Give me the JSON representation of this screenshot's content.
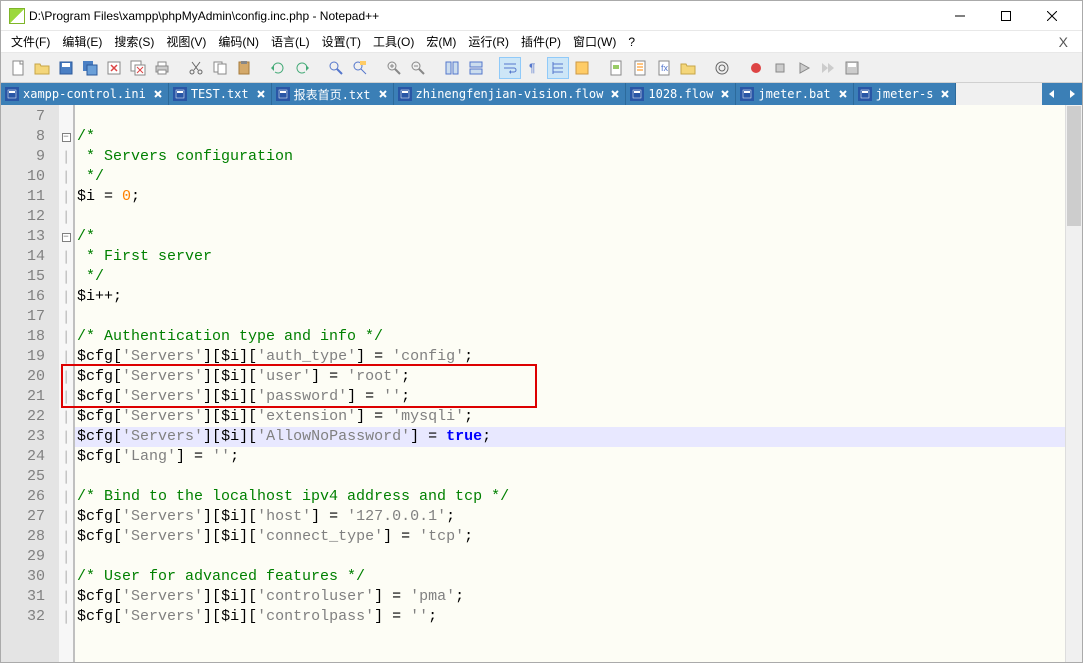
{
  "title": "D:\\Program Files\\xampp\\phpMyAdmin\\config.inc.php - Notepad++",
  "menu": [
    "文件(F)",
    "编辑(E)",
    "搜索(S)",
    "视图(V)",
    "编码(N)",
    "语言(L)",
    "设置(T)",
    "工具(O)",
    "宏(M)",
    "运行(R)",
    "插件(P)",
    "窗口(W)",
    "?"
  ],
  "tabs": [
    {
      "label": "xampp-control.ini"
    },
    {
      "label": "TEST.txt"
    },
    {
      "label": "报表首页.txt"
    },
    {
      "label": "zhinengfenjian-vision.flow"
    },
    {
      "label": "1028.flow"
    },
    {
      "label": "jmeter.bat"
    },
    {
      "label": "jmeter-s"
    }
  ],
  "startLine": 7,
  "lines": [
    {
      "n": 7,
      "fold": "",
      "tokens": []
    },
    {
      "n": 8,
      "fold": "box",
      "tokens": [
        [
          "c-comment",
          "/*"
        ]
      ]
    },
    {
      "n": 9,
      "fold": "|",
      "tokens": [
        [
          "c-comment",
          " * Servers configuration"
        ]
      ]
    },
    {
      "n": 10,
      "fold": "|",
      "tokens": [
        [
          "c-comment",
          " */"
        ]
      ]
    },
    {
      "n": 11,
      "fold": "|",
      "tokens": [
        [
          "c-var",
          "$i"
        ],
        [
          "c-op",
          " = "
        ],
        [
          "c-num",
          "0"
        ],
        [
          "c-op",
          ";"
        ]
      ]
    },
    {
      "n": 12,
      "fold": "|",
      "tokens": []
    },
    {
      "n": 13,
      "fold": "box",
      "tokens": [
        [
          "c-comment",
          "/*"
        ]
      ]
    },
    {
      "n": 14,
      "fold": "|",
      "tokens": [
        [
          "c-comment",
          " * First server"
        ]
      ]
    },
    {
      "n": 15,
      "fold": "|",
      "tokens": [
        [
          "c-comment",
          " */"
        ]
      ]
    },
    {
      "n": 16,
      "fold": "|",
      "tokens": [
        [
          "c-var",
          "$i"
        ],
        [
          "c-op",
          "++;"
        ]
      ]
    },
    {
      "n": 17,
      "fold": "|",
      "tokens": []
    },
    {
      "n": 18,
      "fold": "|",
      "tokens": [
        [
          "c-comment",
          "/* Authentication type and info */"
        ]
      ]
    },
    {
      "n": 19,
      "fold": "|",
      "tokens": [
        [
          "c-var",
          "$cfg"
        ],
        [
          "c-op",
          "["
        ],
        [
          "c-str",
          "'Servers'"
        ],
        [
          "c-op",
          "]["
        ],
        [
          "c-var",
          "$i"
        ],
        [
          "c-op",
          "]["
        ],
        [
          "c-str",
          "'auth_type'"
        ],
        [
          "c-op",
          "] = "
        ],
        [
          "c-str",
          "'config'"
        ],
        [
          "c-op",
          ";"
        ]
      ]
    },
    {
      "n": 20,
      "fold": "|",
      "tokens": [
        [
          "c-var",
          "$cfg"
        ],
        [
          "c-op",
          "["
        ],
        [
          "c-str",
          "'Servers'"
        ],
        [
          "c-op",
          "]["
        ],
        [
          "c-var",
          "$i"
        ],
        [
          "c-op",
          "]["
        ],
        [
          "c-str",
          "'user'"
        ],
        [
          "c-op",
          "] = "
        ],
        [
          "c-str",
          "'root'"
        ],
        [
          "c-op",
          ";"
        ]
      ]
    },
    {
      "n": 21,
      "fold": "|",
      "tokens": [
        [
          "c-var",
          "$cfg"
        ],
        [
          "c-op",
          "["
        ],
        [
          "c-str",
          "'Servers'"
        ],
        [
          "c-op",
          "]["
        ],
        [
          "c-var",
          "$i"
        ],
        [
          "c-op",
          "]["
        ],
        [
          "c-str",
          "'password'"
        ],
        [
          "c-op",
          "] = "
        ],
        [
          "c-str",
          "''"
        ],
        [
          "c-op",
          ";"
        ]
      ]
    },
    {
      "n": 22,
      "fold": "|",
      "tokens": [
        [
          "c-var",
          "$cfg"
        ],
        [
          "c-op",
          "["
        ],
        [
          "c-str",
          "'Servers'"
        ],
        [
          "c-op",
          "]["
        ],
        [
          "c-var",
          "$i"
        ],
        [
          "c-op",
          "]["
        ],
        [
          "c-str",
          "'extension'"
        ],
        [
          "c-op",
          "] = "
        ],
        [
          "c-str",
          "'mysqli'"
        ],
        [
          "c-op",
          ";"
        ]
      ]
    },
    {
      "n": 23,
      "fold": "|",
      "hl": true,
      "tokens": [
        [
          "c-var",
          "$cfg"
        ],
        [
          "c-op",
          "["
        ],
        [
          "c-str",
          "'Servers'"
        ],
        [
          "c-op",
          "]["
        ],
        [
          "c-var",
          "$i"
        ],
        [
          "c-op",
          "]["
        ],
        [
          "c-str",
          "'AllowNoPassword'"
        ],
        [
          "c-op",
          "] = "
        ],
        [
          "c-key",
          "true"
        ],
        [
          "c-op",
          ";"
        ]
      ]
    },
    {
      "n": 24,
      "fold": "|",
      "tokens": [
        [
          "c-var",
          "$cfg"
        ],
        [
          "c-op",
          "["
        ],
        [
          "c-str",
          "'Lang'"
        ],
        [
          "c-op",
          "] = "
        ],
        [
          "c-str",
          "''"
        ],
        [
          "c-op",
          ";"
        ]
      ]
    },
    {
      "n": 25,
      "fold": "|",
      "tokens": []
    },
    {
      "n": 26,
      "fold": "|",
      "tokens": [
        [
          "c-comment",
          "/* Bind to the localhost ipv4 address and tcp */"
        ]
      ]
    },
    {
      "n": 27,
      "fold": "|",
      "tokens": [
        [
          "c-var",
          "$cfg"
        ],
        [
          "c-op",
          "["
        ],
        [
          "c-str",
          "'Servers'"
        ],
        [
          "c-op",
          "]["
        ],
        [
          "c-var",
          "$i"
        ],
        [
          "c-op",
          "]["
        ],
        [
          "c-str",
          "'host'"
        ],
        [
          "c-op",
          "] = "
        ],
        [
          "c-str",
          "'127.0.0.1'"
        ],
        [
          "c-op",
          ";"
        ]
      ]
    },
    {
      "n": 28,
      "fold": "|",
      "tokens": [
        [
          "c-var",
          "$cfg"
        ],
        [
          "c-op",
          "["
        ],
        [
          "c-str",
          "'Servers'"
        ],
        [
          "c-op",
          "]["
        ],
        [
          "c-var",
          "$i"
        ],
        [
          "c-op",
          "]["
        ],
        [
          "c-str",
          "'connect_type'"
        ],
        [
          "c-op",
          "] = "
        ],
        [
          "c-str",
          "'tcp'"
        ],
        [
          "c-op",
          ";"
        ]
      ]
    },
    {
      "n": 29,
      "fold": "|",
      "tokens": []
    },
    {
      "n": 30,
      "fold": "|",
      "tokens": [
        [
          "c-comment",
          "/* User for advanced features */"
        ]
      ]
    },
    {
      "n": 31,
      "fold": "|",
      "tokens": [
        [
          "c-var",
          "$cfg"
        ],
        [
          "c-op",
          "["
        ],
        [
          "c-str",
          "'Servers'"
        ],
        [
          "c-op",
          "]["
        ],
        [
          "c-var",
          "$i"
        ],
        [
          "c-op",
          "]["
        ],
        [
          "c-str",
          "'controluser'"
        ],
        [
          "c-op",
          "] = "
        ],
        [
          "c-str",
          "'pma'"
        ],
        [
          "c-op",
          ";"
        ]
      ]
    },
    {
      "n": 32,
      "fold": "|",
      "tokens": [
        [
          "c-var",
          "$cfg"
        ],
        [
          "c-op",
          "["
        ],
        [
          "c-str",
          "'Servers'"
        ],
        [
          "c-op",
          "]["
        ],
        [
          "c-var",
          "$i"
        ],
        [
          "c-op",
          "]["
        ],
        [
          "c-str",
          "'controlpass'"
        ],
        [
          "c-op",
          "] = "
        ],
        [
          "c-str",
          "''"
        ],
        [
          "c-op",
          ";"
        ]
      ]
    }
  ],
  "highlightBox": {
    "topLine": 20,
    "bottomLine": 22
  }
}
